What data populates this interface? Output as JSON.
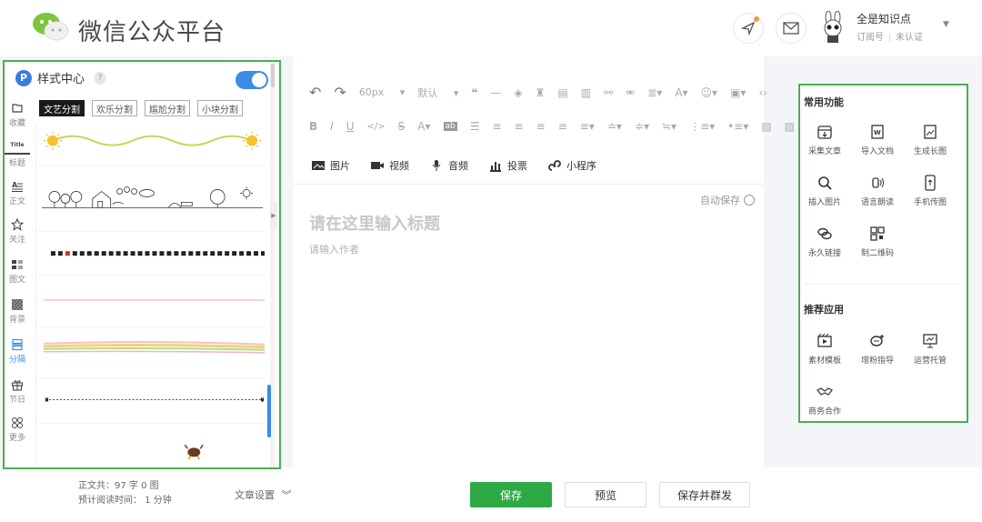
{
  "header": {
    "brand": "微信公众平台",
    "account_name": "全是知识点",
    "account_type": "订阅号",
    "account_status": "未认证"
  },
  "style_panel": {
    "title": "样式中心",
    "badge": "P",
    "help": "?",
    "toggle_on": true,
    "side_nav": [
      {
        "label": "收藏",
        "icon": "folder-icon"
      },
      {
        "label": "标题",
        "icon": "title-icon",
        "glyph": "Title"
      },
      {
        "label": "正文",
        "icon": "text-body-icon"
      },
      {
        "label": "关注",
        "icon": "follow-icon"
      },
      {
        "label": "图文",
        "icon": "image-text-icon"
      },
      {
        "label": "背景",
        "icon": "background-icon"
      },
      {
        "label": "分隔",
        "icon": "divider-icon",
        "active": true
      },
      {
        "label": "节日",
        "icon": "gift-icon"
      },
      {
        "label": "更多",
        "icon": "more-grid-icon"
      }
    ],
    "tabs": [
      {
        "label": "文艺分割",
        "active": true
      },
      {
        "label": "欢乐分割",
        "active": false
      },
      {
        "label": "尴尬分割",
        "active": false
      },
      {
        "label": "小块分割",
        "active": false
      }
    ]
  },
  "editor": {
    "toolbar_row1": {
      "font_size": "60px",
      "font_family": "默认"
    },
    "insert_items": [
      {
        "label": "图片",
        "icon": "image-icon"
      },
      {
        "label": "视频",
        "icon": "video-icon"
      },
      {
        "label": "音频",
        "icon": "audio-icon"
      },
      {
        "label": "投票",
        "icon": "vote-icon"
      },
      {
        "label": "小程序",
        "icon": "mini-program-icon"
      }
    ],
    "autosave": "自动保存",
    "title_placeholder": "请在这里输入标题",
    "author_placeholder": "请输入作者"
  },
  "functions": {
    "common_title": "常用功能",
    "common": [
      {
        "label": "采集文章",
        "icon": "collect-article-icon"
      },
      {
        "label": "导入文档",
        "icon": "import-doc-icon"
      },
      {
        "label": "生成长图",
        "icon": "long-image-icon"
      },
      {
        "label": "插入图片",
        "icon": "search-insert-image-icon"
      },
      {
        "label": "语言朗读",
        "icon": "voice-read-icon"
      },
      {
        "label": "手机传图",
        "icon": "phone-upload-icon"
      },
      {
        "label": "永久链接",
        "icon": "permanent-link-icon"
      },
      {
        "label": "制二维码",
        "icon": "qr-code-icon"
      }
    ],
    "recommend_title": "推荐应用",
    "recommend": [
      {
        "label": "素材模板",
        "icon": "template-icon"
      },
      {
        "label": "增粉指导",
        "icon": "fans-guide-icon"
      },
      {
        "label": "运营托管",
        "icon": "operation-hosting-icon"
      },
      {
        "label": "商务合作",
        "icon": "business-coop-icon"
      }
    ]
  },
  "footer": {
    "word_count": "正文共：97 字 0 图",
    "read_time": "预计阅读时间：  1 分钟",
    "article_settings": "文章设置",
    "save": "保存",
    "preview": "预览",
    "save_publish": "保存并群发"
  },
  "colors": {
    "accent": "#3c8ce7",
    "save_green": "#2eaa45",
    "highlight_border": "#4caf50"
  }
}
